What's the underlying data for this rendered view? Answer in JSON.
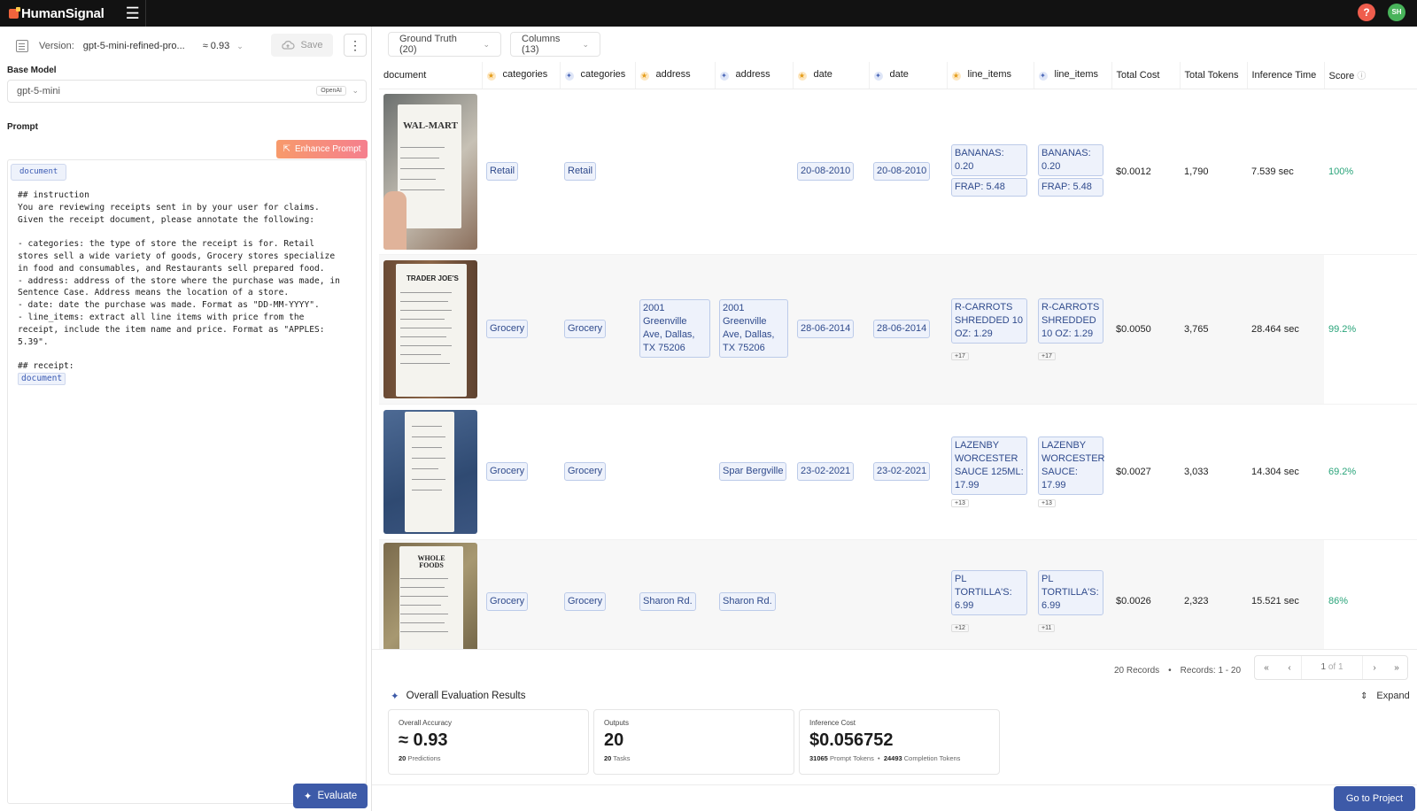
{
  "app": {
    "brand": "HumanSignal",
    "avatar_initials": "SH",
    "help_glyph": "?"
  },
  "version": {
    "label": "Version:",
    "name": "gpt-5-mini-refined-pro...",
    "score": "≈ 0.93"
  },
  "toolbar": {
    "save_label": "Save"
  },
  "base_model": {
    "label": "Base Model",
    "value": "gpt-5-mini",
    "provider": "OpenAI"
  },
  "prompt": {
    "label": "Prompt",
    "enhance_label": "Enhance Prompt",
    "variable_chip": "document",
    "text": "## instruction\nYou are reviewing receipts sent in by your user for claims.\nGiven the receipt document, please annotate the following:\n\n- categories: the type of store the receipt is for. Retail\nstores sell a wide variety of goods, Grocery stores specialize\nin food and consumables, and Restaurants sell prepared food.\n- address: address of the store where the purchase was made, in\nSentence Case. Address means the location of a store.\n- date: date the purchase was made. Format as \"DD-MM-YYYY\".\n- line_items: extract all line items with price from the\nreceipt, include the item name and price. Format as \"APPLES:\n5.39\".\n\n## receipt:",
    "trailing_chip": "document"
  },
  "evaluate_label": "Evaluate",
  "filters": {
    "ground_truth": "Ground Truth (20)",
    "columns": "Columns (13)"
  },
  "table": {
    "headers": [
      "document",
      "categories",
      "categories",
      "address",
      "address",
      "date",
      "date",
      "line_items",
      "line_items",
      "Total Cost",
      "Total Tokens",
      "Inference Time",
      "Score"
    ],
    "rows": [
      {
        "gt_category": "Retail",
        "pred_category": "Retail",
        "gt_address": "",
        "pred_address": "",
        "gt_date": "20-08-2010",
        "pred_date": "20-08-2010",
        "gt_items": [
          "BANANAS: 0.20",
          "FRAP: 5.48"
        ],
        "gt_more": "",
        "pred_items": [
          "BANANAS: 0.20",
          "FRAP: 5.48"
        ],
        "pred_more": "",
        "cost": "$0.0012",
        "tokens": "1,790",
        "time": "7.539 sec",
        "score": "100%",
        "receipt_name": "WAL-MART"
      },
      {
        "gt_category": "Grocery",
        "pred_category": "Grocery",
        "gt_address": "2001 Greenville Ave, Dallas, TX 75206",
        "pred_address": "2001 Greenville Ave, Dallas, TX 75206",
        "gt_date": "28-06-2014",
        "pred_date": "28-06-2014",
        "gt_items": [
          "R-CARROTS SHREDDED 10 OZ: 1.29"
        ],
        "gt_more": "+17",
        "pred_items": [
          "R-CARROTS SHREDDED 10 OZ: 1.29"
        ],
        "pred_more": "+17",
        "cost": "$0.0050",
        "tokens": "3,765",
        "time": "28.464 sec",
        "score": "99.2%",
        "receipt_name": "TRADER JOE'S"
      },
      {
        "gt_category": "Grocery",
        "pred_category": "Grocery",
        "gt_address": "",
        "pred_address": "Spar Bergville",
        "gt_date": "23-02-2021",
        "pred_date": "23-02-2021",
        "gt_items": [
          "LAZENBY WORCESTER SAUCE 125ML: 17.99"
        ],
        "gt_more": "+13",
        "pred_items": [
          "LAZENBY WORCESTER SAUCE: 17.99"
        ],
        "pred_more": "+13",
        "cost": "$0.0027",
        "tokens": "3,033",
        "time": "14.304 sec",
        "score": "69.2%",
        "receipt_name": ""
      },
      {
        "gt_category": "Grocery",
        "pred_category": "Grocery",
        "gt_address": "Sharon Rd.",
        "pred_address": "Sharon Rd.",
        "gt_date": "",
        "pred_date": "",
        "gt_items": [
          "PL TORTILLA'S: 6.99"
        ],
        "gt_more": "+12",
        "pred_items": [
          "PL TORTILLA'S: 6.99"
        ],
        "pred_more": "+11",
        "cost": "$0.0026",
        "tokens": "2,323",
        "time": "15.521 sec",
        "score": "86%",
        "receipt_name": "WHOLE FOODS"
      }
    ]
  },
  "pagination": {
    "records": "20 Records",
    "range": "Records: 1 - 20",
    "page": "1",
    "of": "of 1"
  },
  "evaluation": {
    "title": "Overall Evaluation Results",
    "expand_label": "Expand",
    "cards": [
      {
        "title": "Overall Accuracy",
        "value": "≈ 0.93",
        "sub_count": "20",
        "sub_label": "Predictions"
      },
      {
        "title": "Outputs",
        "value": "20",
        "sub_count": "20",
        "sub_label": "Tasks"
      },
      {
        "title": "Inference Cost",
        "value": "$0.056752",
        "sub_count": "31065",
        "sub_label": "Prompt Tokens",
        "sub_count2": "24493",
        "sub_label2": "Completion Tokens"
      }
    ]
  },
  "go_to_project_label": "Go to Project",
  "colors": {
    "primary": "#3d5aa8",
    "topbar": "#121212",
    "score_green": "#2aa47a",
    "chip_bg": "#eef2fb",
    "chip_border": "#bccbe9",
    "enhance_from": "#f79a6b",
    "enhance_to": "#f57f8e"
  }
}
